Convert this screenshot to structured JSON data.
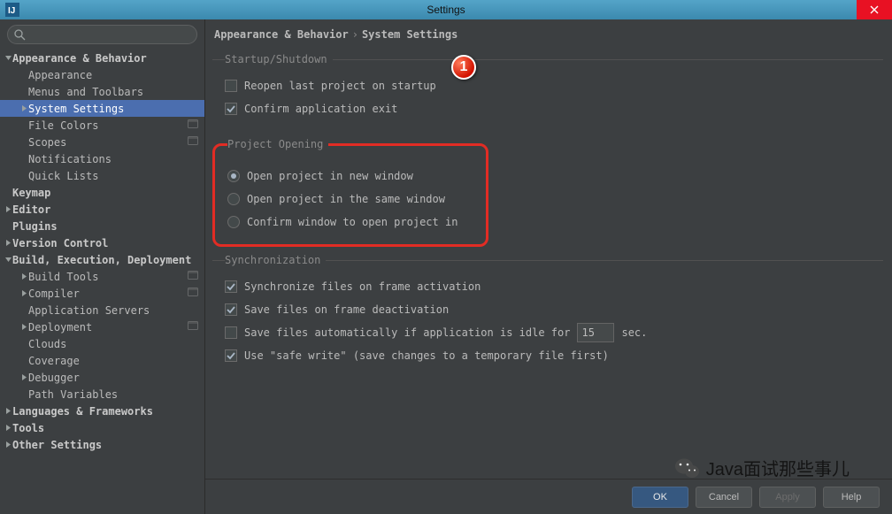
{
  "window": {
    "title": "Settings"
  },
  "search": {
    "value": ""
  },
  "sidebar": [
    {
      "label": "Appearance & Behavior",
      "level": 0,
      "bold": true,
      "arrow": "down"
    },
    {
      "label": "Appearance",
      "level": 1
    },
    {
      "label": "Menus and Toolbars",
      "level": 1
    },
    {
      "label": "System Settings",
      "level": 1,
      "arrow": "right",
      "selected": true
    },
    {
      "label": "File Colors",
      "level": 1,
      "proj": true
    },
    {
      "label": "Scopes",
      "level": 1,
      "proj": true
    },
    {
      "label": "Notifications",
      "level": 1
    },
    {
      "label": "Quick Lists",
      "level": 1
    },
    {
      "label": "Keymap",
      "level": 0,
      "bold": true
    },
    {
      "label": "Editor",
      "level": 0,
      "bold": true,
      "arrow": "right"
    },
    {
      "label": "Plugins",
      "level": 0,
      "bold": true
    },
    {
      "label": "Version Control",
      "level": 0,
      "bold": true,
      "arrow": "right"
    },
    {
      "label": "Build, Execution, Deployment",
      "level": 0,
      "bold": true,
      "arrow": "down"
    },
    {
      "label": "Build Tools",
      "level": 1,
      "arrow": "right",
      "proj": true
    },
    {
      "label": "Compiler",
      "level": 1,
      "arrow": "right",
      "proj": true
    },
    {
      "label": "Application Servers",
      "level": 1
    },
    {
      "label": "Deployment",
      "level": 1,
      "arrow": "right",
      "proj": true
    },
    {
      "label": "Clouds",
      "level": 1
    },
    {
      "label": "Coverage",
      "level": 1
    },
    {
      "label": "Debugger",
      "level": 1,
      "arrow": "right"
    },
    {
      "label": "Path Variables",
      "level": 1
    },
    {
      "label": "Languages & Frameworks",
      "level": 0,
      "bold": true,
      "arrow": "right"
    },
    {
      "label": "Tools",
      "level": 0,
      "bold": true,
      "arrow": "right"
    },
    {
      "label": "Other Settings",
      "level": 0,
      "bold": true,
      "arrow": "right"
    }
  ],
  "breadcrumb": {
    "part1": "Appearance & Behavior",
    "sep": "›",
    "part2": "System Settings"
  },
  "groups": {
    "startup": {
      "legend": "Startup/Shutdown",
      "reopen": {
        "label": "Reopen last project on startup",
        "checked": false
      },
      "confirmExit": {
        "label": "Confirm application exit",
        "checked": true
      }
    },
    "projectOpening": {
      "legend": "Project Opening",
      "opt1": {
        "label": "Open project in new window",
        "checked": true
      },
      "opt2": {
        "label": "Open project in the same window",
        "checked": false
      },
      "opt3": {
        "label": "Confirm window to open project in",
        "checked": false
      }
    },
    "sync": {
      "legend": "Synchronization",
      "syncFrame": {
        "label": "Synchronize files on frame activation",
        "checked": true
      },
      "saveDeact": {
        "label": "Save files on frame deactivation",
        "checked": true
      },
      "autosave": {
        "label_before": "Save files automatically if application is idle for",
        "value": "15",
        "label_after": "sec.",
        "checked": false
      },
      "safeWrite": {
        "label": "Use \"safe write\" (save changes to a temporary file first)",
        "checked": true
      }
    }
  },
  "callout": {
    "number": "1"
  },
  "footer": {
    "ok": "OK",
    "cancel": "Cancel",
    "apply": "Apply",
    "help": "Help"
  },
  "watermark": {
    "text": "Java面试那些事儿"
  }
}
